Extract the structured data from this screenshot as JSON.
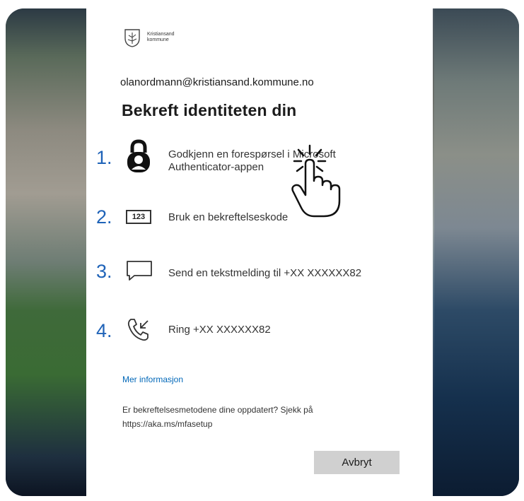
{
  "brand": {
    "line1": "Kristiansand",
    "line2": "kommune"
  },
  "account": {
    "email": "olanordmann@kristiansand.kommune.no"
  },
  "heading": "Bekreft identiteten din",
  "options": [
    {
      "number": "1.",
      "line1": "Godkjenn en forespørsel i Microsoft",
      "line2": "Authenticator-appen",
      "icon": "lock-icon"
    },
    {
      "number": "2.",
      "text": "Bruk en bekreftelseskode",
      "icon_text": "123",
      "icon": "code-icon"
    },
    {
      "number": "3.",
      "text": "Send en tekstmelding til +XX XXXXXX82",
      "icon": "message-icon"
    },
    {
      "number": "4.",
      "text": "Ring +XX XXXXXX82",
      "icon": "phone-icon"
    }
  ],
  "more_info": "Mer informasjon",
  "note": {
    "line1": "Er bekreftelsesmetodene dine oppdatert? Sjekk på",
    "line2": "https://aka.ms/mfasetup"
  },
  "cancel_label": "Avbryt",
  "colors": {
    "accent": "#1f63b8",
    "link": "#0067b8",
    "button": "#d0d0d0"
  }
}
